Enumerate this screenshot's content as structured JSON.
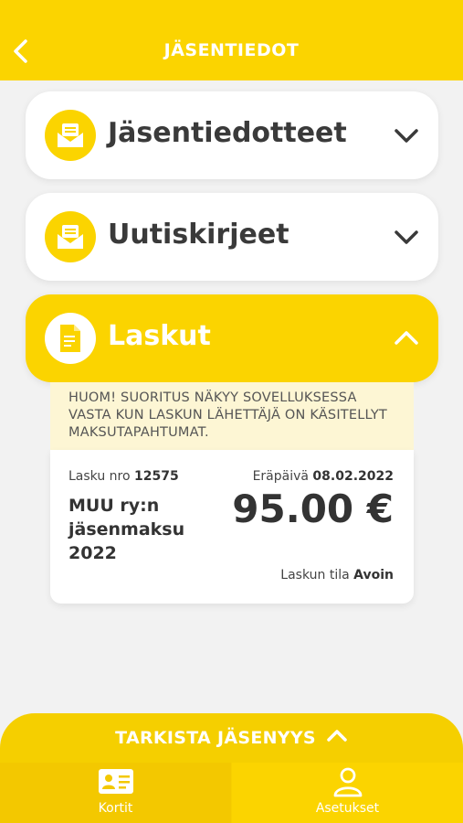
{
  "header": {
    "title": "JÄSENTIEDOT"
  },
  "sections": [
    {
      "label": "Jäsentiedotteet",
      "icon": "envelope-letter-icon",
      "expanded": false
    },
    {
      "label": "Uutiskirjeet",
      "icon": "envelope-letter-icon",
      "expanded": false
    },
    {
      "label": "Laskut",
      "icon": "invoice-document-icon",
      "expanded": true
    }
  ],
  "notice": {
    "text": "HUOM! SUORITUS NÄKYY SOVELLUKSESSA VASTA KUN LASKUN LÄHETTÄJÄ ON KÄSITELLYT MAKSUTAPAHTUMAT."
  },
  "invoice": {
    "number_label": "Lasku nro",
    "number": "12575",
    "title": "MUU ry:n jäsenmaksu 2022",
    "due_label": "Eräpäivä",
    "due_date": "08.02.2022",
    "amount": "95.00 €",
    "status_label": "Laskun tila",
    "status": "Avoin"
  },
  "check_bar": {
    "label": "TARKISTA JÄSENYYS"
  },
  "tabs": [
    {
      "label": "Kortit",
      "icon": "id-card-icon"
    },
    {
      "label": "Asetukset",
      "icon": "user-icon"
    }
  ],
  "colors": {
    "brand_yellow": "#fbd400",
    "text_dark": "#3a3a3a",
    "notice_bg": "#fdf6d4"
  }
}
